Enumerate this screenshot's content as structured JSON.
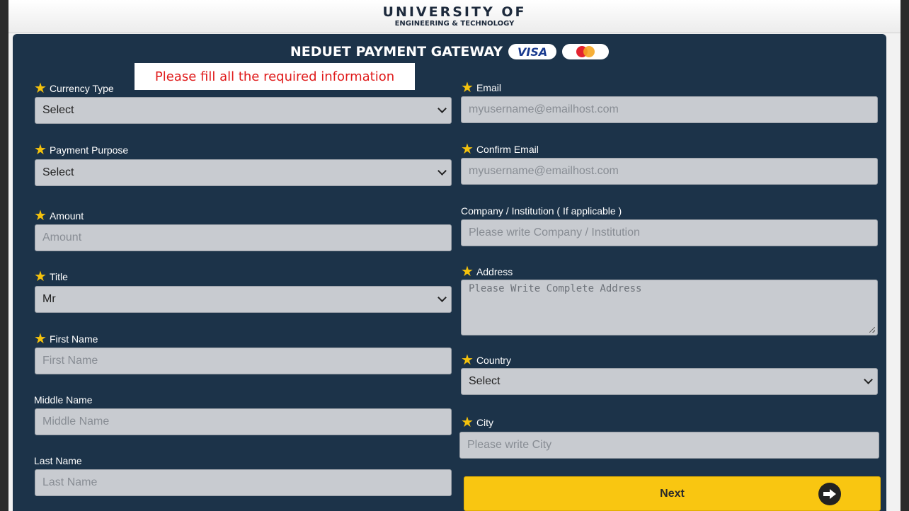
{
  "header": {
    "line1": "UNIVERSITY OF",
    "line2": "ENGINEERING & TECHNOLOGY"
  },
  "gateway": {
    "title": "NEDUET PAYMENT GATEWAY",
    "visa_label": "VISA",
    "mastercard_label": "MasterCard"
  },
  "alert": {
    "message": "Please fill all the required information"
  },
  "form": {
    "currency_type": {
      "label": "Currency Type",
      "value": "Select"
    },
    "payment_purpose": {
      "label": "Payment Purpose",
      "value": "Select"
    },
    "amount": {
      "label": "Amount",
      "placeholder": "Amount"
    },
    "title": {
      "label": "Title",
      "value": "Mr"
    },
    "first_name": {
      "label": "First Name",
      "placeholder": "First Name"
    },
    "middle_name": {
      "label": "Middle Name",
      "placeholder": "Middle Name"
    },
    "last_name": {
      "label": "Last Name",
      "placeholder": "Last Name"
    },
    "email": {
      "label": "Email",
      "placeholder": "myusername@emailhost.com"
    },
    "confirm_email": {
      "label": "Confirm Email",
      "placeholder": "myusername@emailhost.com"
    },
    "company": {
      "label": "Company / Institution ( If applicable )",
      "placeholder": "Please write Company / Institution"
    },
    "address": {
      "label": "Address",
      "placeholder": "Please Write Complete Address"
    },
    "country": {
      "label": "Country",
      "value": "Select"
    },
    "city": {
      "label": "City",
      "placeholder": "Please write City"
    },
    "next_label": "Next"
  },
  "colors": {
    "panel_bg": "#1c3349",
    "required_star": "#f4c20d",
    "next_button": "#f9c611",
    "alert_text": "#e01b1b"
  },
  "icons": {
    "required": "star-icon",
    "dropdown": "chevron-down-icon",
    "next": "arrow-right-circle-icon"
  }
}
